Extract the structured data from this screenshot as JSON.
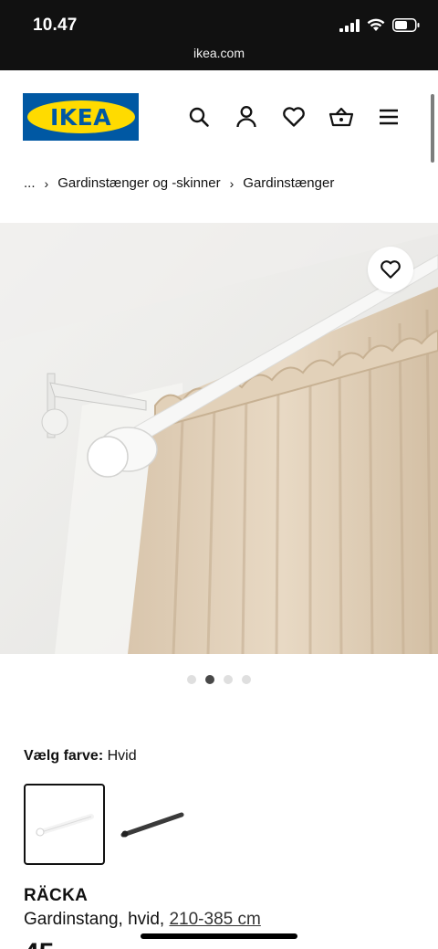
{
  "status_bar": {
    "time": "10.47",
    "url": "ikea.com"
  },
  "header": {
    "logo_text": "IKEA",
    "icons": [
      "search-icon",
      "user-icon",
      "heart-icon",
      "basket-icon",
      "menu-icon"
    ]
  },
  "breadcrumb": {
    "ellipsis": "...",
    "items": [
      "Gardinstænger og -skinner",
      "Gardinstænger"
    ]
  },
  "gallery": {
    "image_count": 4,
    "active_index": 1
  },
  "color_picker": {
    "label": "Vælg farve:",
    "selected_value": "Hvid"
  },
  "product": {
    "name": "RÄCKA",
    "desc_prefix": "Gardinstang, hvid, ",
    "length": "210-385 cm",
    "price_peek": "45"
  },
  "colors": {
    "ikea_blue": "#0058a3",
    "ikea_yellow": "#ffdb00"
  }
}
